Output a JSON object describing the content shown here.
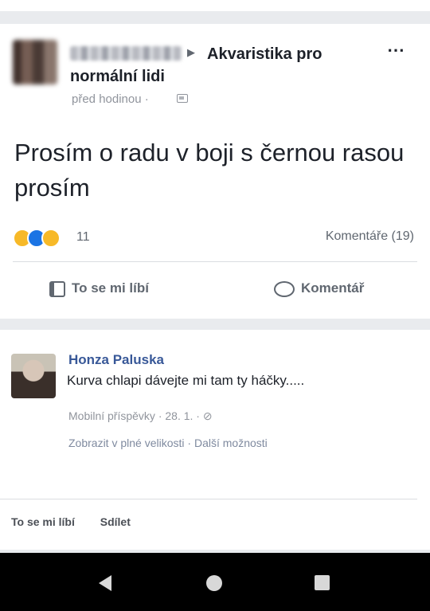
{
  "post": {
    "group_name": "Akvaristika pro normální lidi",
    "time": "před hodinou",
    "text": "Prosím o radu v boji s černou rasou prosím",
    "reaction_count": "11",
    "comments_count": "Komentáře (19)",
    "like_label": "To se mi líbí",
    "comment_label": "Komentář",
    "more_icon": "⋯"
  },
  "comment": {
    "author": "Honza Paluska",
    "text": "Kurva chlapi dávejte mi tam ty háčky.....",
    "meta": "Mobilní příspěvky · 28. 1. · ",
    "link_full": "Zobrazit v plné velikosti",
    "link_separator": " · ",
    "link_more": "Další možnosti",
    "like_action": "To se mi líbí",
    "share_action": "Sdílet"
  },
  "icons": {
    "haha": "😆",
    "like": "👍",
    "wow": "😮"
  }
}
